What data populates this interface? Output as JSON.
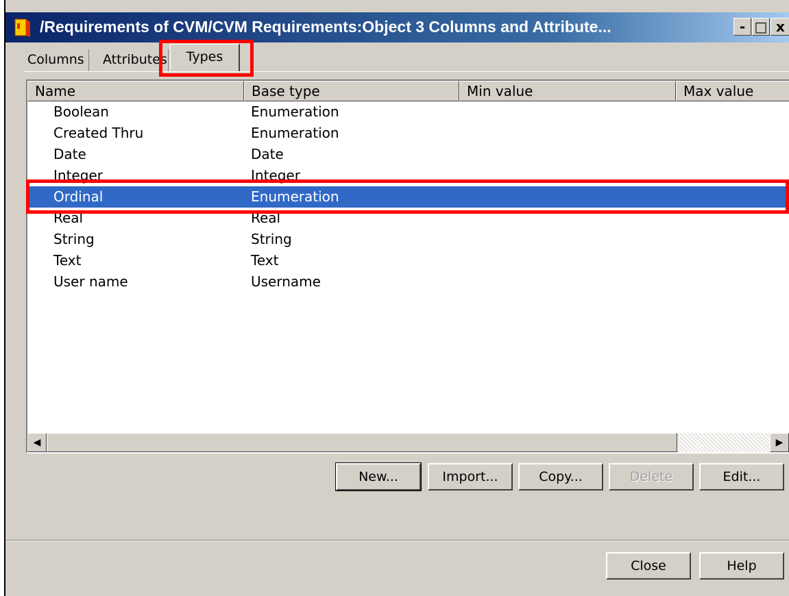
{
  "window": {
    "title": "/Requirements of CVM/CVM Requirements:Object 3 Columns and Attribute...",
    "controls": {
      "minimize": "-",
      "maximize": "□",
      "close": "x"
    }
  },
  "tabs": [
    {
      "label": "Columns"
    },
    {
      "label": "Attributes"
    },
    {
      "label": "Types"
    }
  ],
  "active_tab": "Types",
  "table": {
    "headers": [
      "Name",
      "Base type",
      "Min value",
      "Max value"
    ],
    "rows": [
      {
        "name": "Boolean",
        "base_type": "Enumeration"
      },
      {
        "name": "Created Thru",
        "base_type": "Enumeration"
      },
      {
        "name": "Date",
        "base_type": "Date"
      },
      {
        "name": "Integer",
        "base_type": "Integer"
      },
      {
        "name": "Ordinal",
        "base_type": "Enumeration"
      },
      {
        "name": "Real",
        "base_type": "Real"
      },
      {
        "name": "String",
        "base_type": "String"
      },
      {
        "name": "Text",
        "base_type": "Text"
      },
      {
        "name": "User name",
        "base_type": "Username"
      }
    ],
    "selected_row": "Ordinal"
  },
  "scrollbar": {
    "left_arrow": "◀",
    "right_arrow": "▶"
  },
  "actions": {
    "new": "New...",
    "import": "Import...",
    "copy": "Copy...",
    "delete": "Delete",
    "edit": "Edit..."
  },
  "footer": {
    "close": "Close",
    "help": "Help"
  },
  "colors": {
    "selection": "#3169c6",
    "highlight_box": "#ff0000",
    "title_bar": "#0a246a"
  }
}
